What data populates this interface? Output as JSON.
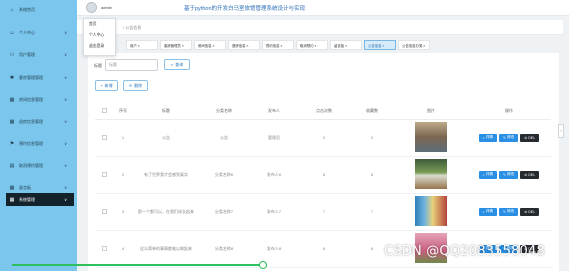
{
  "sidebar": {
    "items": [
      {
        "label": "系统首页",
        "icon": "home-icon",
        "glyph": "⌂"
      },
      {
        "label": "个人中心",
        "icon": "user-icon",
        "glyph": "☺",
        "chevron": "∨"
      },
      {
        "label": "用户管理",
        "icon": "users-icon",
        "glyph": "⚇",
        "chevron": "∨"
      },
      {
        "label": "客房管理管理",
        "icon": "gear-icon",
        "glyph": "✱",
        "chevron": "∨"
      },
      {
        "label": "房间信息管理",
        "icon": "grid-icon",
        "glyph": "▦",
        "chevron": "∨"
      },
      {
        "label": "退房信息管理",
        "icon": "grid-icon",
        "glyph": "▦",
        "chevron": "∨"
      },
      {
        "label": "预约信息管理",
        "icon": "flag-icon",
        "glyph": "⚑",
        "chevron": "∨"
      },
      {
        "label": "取消预约管理",
        "icon": "doc-icon",
        "glyph": "▤",
        "chevron": "∨"
      },
      {
        "label": "留言板",
        "icon": "grid-icon",
        "glyph": "▦",
        "chevron": "∨"
      },
      {
        "label": "系统管理",
        "icon": "grid-icon",
        "glyph": "▦",
        "chevron": "∨",
        "active": true
      }
    ]
  },
  "header": {
    "username": "admin",
    "app_title": "基于python的开发白马室旅馆管理系统设计与实现"
  },
  "user_menu": {
    "items": [
      "首页",
      "个人中心",
      "退出登录"
    ]
  },
  "breadcrumb": {
    "text": "/ 公告信息"
  },
  "tabs": [
    {
      "label": "用户 ×"
    },
    {
      "label": "客房管理员 ×"
    },
    {
      "label": "房间信息 ×"
    },
    {
      "label": "退房信息 ×"
    },
    {
      "label": "预约信息 ×"
    },
    {
      "label": "取消预约 ×"
    },
    {
      "label": "留言板 ×"
    },
    {
      "label": "公告信息 ×",
      "active": true
    },
    {
      "label": "公告信息分类 ×"
    }
  ],
  "search": {
    "label": "标题",
    "placeholder": "标题",
    "button": "查询",
    "button_glyph": "⌕"
  },
  "actions": {
    "add": "新增",
    "add_glyph": "+",
    "delete": "删除",
    "delete_glyph": "⊖"
  },
  "table": {
    "columns": [
      "序号",
      "标题",
      "分类名称",
      "发布人",
      "点击次数",
      "收藏数",
      "图片",
      "操作"
    ],
    "rows": [
      {
        "index": "1",
        "title": "公告",
        "category": "公告",
        "publisher": "管理员",
        "clicks": "0",
        "favorites": "0",
        "image": "street-photo"
      },
      {
        "index": "2",
        "title": "有了世界我才会感到真实",
        "category": "分类名称6",
        "publisher": "发布人6",
        "clicks": "6",
        "favorites": "6",
        "image": "room-photo"
      },
      {
        "index": "3",
        "title": "那一个都可以，在我们成长起来",
        "category": "分类名称7",
        "publisher": "发布人7",
        "clicks": "7",
        "favorites": "7",
        "image": "book-photo"
      },
      {
        "index": "4",
        "title": "这么简单的事情都难以做起来",
        "category": "分类名称8",
        "publisher": "发布人8",
        "clicks": "8",
        "favorites": "8",
        "image": "flower-photo"
      }
    ],
    "buttons": {
      "detail": "详情",
      "detail_glyph": "⌕",
      "edit": "修改",
      "edit_glyph": "✎",
      "del": "DEL",
      "del_glyph": "⊘"
    }
  },
  "scroll_handle": "›",
  "watermark": "CSDN @QQ2083558048",
  "colors": {
    "sidebar": "#7bc6ec",
    "sidebar_active": "#14222c",
    "accent": "#2a8fe4",
    "delete": "#262b30",
    "title": "#2d6fb6"
  }
}
